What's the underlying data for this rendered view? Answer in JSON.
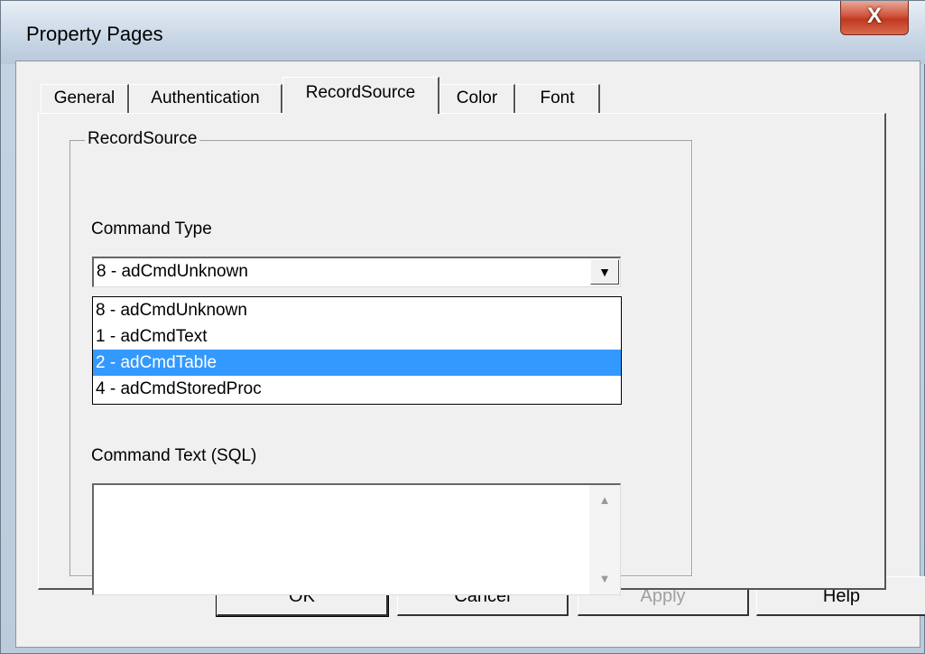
{
  "window": {
    "title": "Property Pages",
    "close_glyph": "X"
  },
  "tabs": [
    {
      "label": "General"
    },
    {
      "label": "Authentication"
    },
    {
      "label": "RecordSource"
    },
    {
      "label": "Color"
    },
    {
      "label": "Font"
    }
  ],
  "active_tab": "RecordSource",
  "recordsource": {
    "group_title": "RecordSource",
    "command_type_label": "Command Type",
    "command_type_value": "8 - adCmdUnknown",
    "options": [
      {
        "label": "8 - adCmdUnknown"
      },
      {
        "label": "1 - adCmdText"
      },
      {
        "label": "2 - adCmdTable"
      },
      {
        "label": "4 - adCmdStoredProc"
      }
    ],
    "highlighted_option": "2 - adCmdTable",
    "command_text_label": "Command Text (SQL)",
    "command_text_value": ""
  },
  "buttons": {
    "ok": "OK",
    "cancel": "Cancel",
    "apply": "Apply",
    "help": "Help"
  }
}
